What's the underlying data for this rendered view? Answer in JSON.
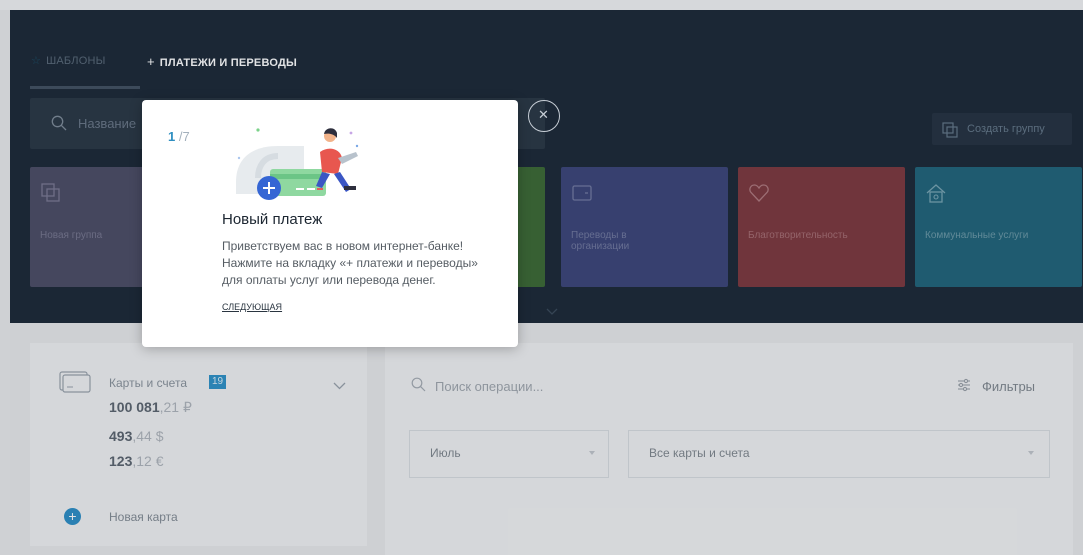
{
  "nav": {
    "tabs": [
      {
        "label": "ШАБЛОНЫ",
        "icon": "star-icon"
      },
      {
        "label": "ПЛАТЕЖИ И ПЕРЕВОДЫ",
        "icon": "plus-icon"
      }
    ]
  },
  "search": {
    "placeholder": "Название"
  },
  "create_group": {
    "label": "Создать группу",
    "icon": "group-copy-icon"
  },
  "tiles": [
    {
      "label": "Новая группа",
      "icon": "group-icon",
      "color": "#4d4e66"
    },
    {
      "label": "",
      "icon": "",
      "color": "#3d6a35"
    },
    {
      "label_lines": [
        "Переводы в",
        "организации"
      ],
      "icon": "wallet-icon",
      "color": "#3d4679"
    },
    {
      "label": "Благотворительность",
      "icon": "heart-icon",
      "color": "#7e3a3f"
    },
    {
      "label": "Коммунальные услуги",
      "icon": "house-icon",
      "color": "#21657a"
    }
  ],
  "accounts": {
    "title": "Карты и счета",
    "count": "19",
    "balances": [
      {
        "main": "100 081",
        "frac": ",21 ₽"
      },
      {
        "main": "493",
        "frac": ",44 $"
      },
      {
        "main": "123",
        "frac": ",12 €"
      }
    ],
    "new_card_label": "Новая карта"
  },
  "operations": {
    "search_placeholder": "Поиск операции...",
    "filters_label": "Фильтры",
    "month_select": "Июль",
    "cards_select": "Все карты и счета"
  },
  "tour": {
    "step_current": "1",
    "step_total": " /7",
    "title": "Новый платеж",
    "body_lines": [
      "Приветствуем вас в новом интернет-банке!",
      "Нажмите на вкладку «+ платежи и переводы»",
      "для оплаты услуг или перевода денег."
    ],
    "next_label": "СЛЕДУЮЩАЯ",
    "close_icon": "close-icon"
  },
  "colors": {
    "header_bg": "#1d2a37",
    "accent_blue": "#2f8fc1",
    "badge_blue": "#2f92c8",
    "page_bg": "#e9eaeb"
  }
}
